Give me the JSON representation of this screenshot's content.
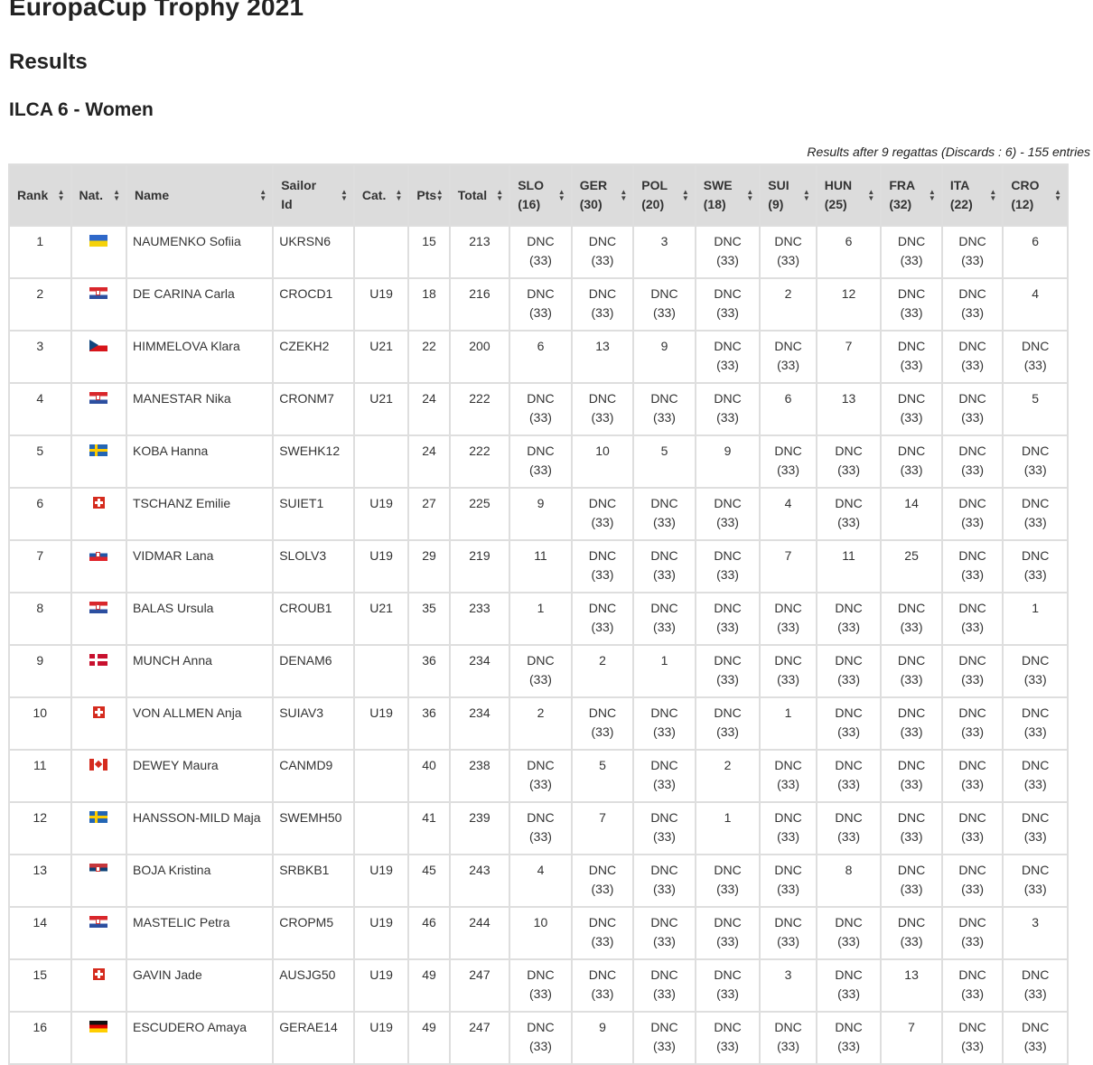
{
  "page": {
    "title": "EuropaCup Trophy 2021",
    "section": "Results",
    "category": "ILCA 6 - Women",
    "summary": "Results after 9 regattas (Discards : 6) - 155 entries"
  },
  "table": {
    "columns": [
      "Rank",
      "Nat.",
      "Name",
      "Sailor Id",
      "Cat.",
      "Pts",
      "Total",
      "SLO (16)",
      "GER (30)",
      "POL (20)",
      "SWE (18)",
      "SUI (9)",
      "HUN (25)",
      "FRA (32)",
      "ITA (22)",
      "CRO (12)"
    ],
    "rows": [
      {
        "rank": "1",
        "flag": "ukr",
        "name": "NAUMENKO Sofiia",
        "id": "UKRSN6",
        "cat": "",
        "pts": "15",
        "total": "213",
        "r": [
          [
            "DNC",
            "(33)"
          ],
          [
            "DNC",
            "(33)"
          ],
          [
            "3",
            ""
          ],
          [
            "DNC",
            "(33)"
          ],
          [
            "DNC",
            "(33)"
          ],
          [
            "6",
            ""
          ],
          [
            "DNC",
            "(33)"
          ],
          [
            "DNC",
            "(33)"
          ],
          [
            "6",
            ""
          ]
        ]
      },
      {
        "rank": "2",
        "flag": "cro",
        "name": "DE CARINA Carla",
        "id": "CROCD1",
        "cat": "U19",
        "pts": "18",
        "total": "216",
        "r": [
          [
            "DNC",
            "(33)"
          ],
          [
            "DNC",
            "(33)"
          ],
          [
            "DNC",
            "(33)"
          ],
          [
            "DNC",
            "(33)"
          ],
          [
            "2",
            ""
          ],
          [
            "12",
            ""
          ],
          [
            "DNC",
            "(33)"
          ],
          [
            "DNC",
            "(33)"
          ],
          [
            "4",
            ""
          ]
        ]
      },
      {
        "rank": "3",
        "flag": "cze",
        "name": "HIMMELOVA Klara",
        "id": "CZEKH2",
        "cat": "U21",
        "pts": "22",
        "total": "200",
        "r": [
          [
            "6",
            ""
          ],
          [
            "13",
            ""
          ],
          [
            "9",
            ""
          ],
          [
            "DNC",
            "(33)"
          ],
          [
            "DNC",
            "(33)"
          ],
          [
            "7",
            ""
          ],
          [
            "DNC",
            "(33)"
          ],
          [
            "DNC",
            "(33)"
          ],
          [
            "DNC",
            "(33)"
          ]
        ]
      },
      {
        "rank": "4",
        "flag": "cro",
        "name": "MANESTAR Nika",
        "id": "CRONM7",
        "cat": "U21",
        "pts": "24",
        "total": "222",
        "r": [
          [
            "DNC",
            "(33)"
          ],
          [
            "DNC",
            "(33)"
          ],
          [
            "DNC",
            "(33)"
          ],
          [
            "DNC",
            "(33)"
          ],
          [
            "6",
            ""
          ],
          [
            "13",
            ""
          ],
          [
            "DNC",
            "(33)"
          ],
          [
            "DNC",
            "(33)"
          ],
          [
            "5",
            ""
          ]
        ]
      },
      {
        "rank": "5",
        "flag": "swe",
        "name": "KOBA Hanna",
        "id": "SWEHK12",
        "cat": "",
        "pts": "24",
        "total": "222",
        "r": [
          [
            "DNC",
            "(33)"
          ],
          [
            "10",
            ""
          ],
          [
            "5",
            ""
          ],
          [
            "9",
            ""
          ],
          [
            "DNC",
            "(33)"
          ],
          [
            "DNC",
            "(33)"
          ],
          [
            "DNC",
            "(33)"
          ],
          [
            "DNC",
            "(33)"
          ],
          [
            "DNC",
            "(33)"
          ]
        ]
      },
      {
        "rank": "6",
        "flag": "sui",
        "name": "TSCHANZ Emilie",
        "id": "SUIET1",
        "cat": "U19",
        "pts": "27",
        "total": "225",
        "r": [
          [
            "9",
            ""
          ],
          [
            "DNC",
            "(33)"
          ],
          [
            "DNC",
            "(33)"
          ],
          [
            "DNC",
            "(33)"
          ],
          [
            "4",
            ""
          ],
          [
            "DNC",
            "(33)"
          ],
          [
            "14",
            ""
          ],
          [
            "DNC",
            "(33)"
          ],
          [
            "DNC",
            "(33)"
          ]
        ]
      },
      {
        "rank": "7",
        "flag": "slo",
        "name": "VIDMAR Lana",
        "id": "SLOLV3",
        "cat": "U19",
        "pts": "29",
        "total": "219",
        "r": [
          [
            "11",
            ""
          ],
          [
            "DNC",
            "(33)"
          ],
          [
            "DNC",
            "(33)"
          ],
          [
            "DNC",
            "(33)"
          ],
          [
            "7",
            ""
          ],
          [
            "11",
            ""
          ],
          [
            "25",
            ""
          ],
          [
            "DNC",
            "(33)"
          ],
          [
            "DNC",
            "(33)"
          ]
        ]
      },
      {
        "rank": "8",
        "flag": "cro",
        "name": "BALAS Ursula",
        "id": "CROUB1",
        "cat": "U21",
        "pts": "35",
        "total": "233",
        "r": [
          [
            "1",
            ""
          ],
          [
            "DNC",
            "(33)"
          ],
          [
            "DNC",
            "(33)"
          ],
          [
            "DNC",
            "(33)"
          ],
          [
            "DNC",
            "(33)"
          ],
          [
            "DNC",
            "(33)"
          ],
          [
            "DNC",
            "(33)"
          ],
          [
            "DNC",
            "(33)"
          ],
          [
            "1",
            ""
          ]
        ]
      },
      {
        "rank": "9",
        "flag": "den",
        "name": "MUNCH Anna",
        "id": "DENAM6",
        "cat": "",
        "pts": "36",
        "total": "234",
        "r": [
          [
            "DNC",
            "(33)"
          ],
          [
            "2",
            ""
          ],
          [
            "1",
            ""
          ],
          [
            "DNC",
            "(33)"
          ],
          [
            "DNC",
            "(33)"
          ],
          [
            "DNC",
            "(33)"
          ],
          [
            "DNC",
            "(33)"
          ],
          [
            "DNC",
            "(33)"
          ],
          [
            "DNC",
            "(33)"
          ]
        ]
      },
      {
        "rank": "10",
        "flag": "sui",
        "name": "VON ALLMEN Anja",
        "id": "SUIAV3",
        "cat": "U19",
        "pts": "36",
        "total": "234",
        "r": [
          [
            "2",
            ""
          ],
          [
            "DNC",
            "(33)"
          ],
          [
            "DNC",
            "(33)"
          ],
          [
            "DNC",
            "(33)"
          ],
          [
            "1",
            ""
          ],
          [
            "DNC",
            "(33)"
          ],
          [
            "DNC",
            "(33)"
          ],
          [
            "DNC",
            "(33)"
          ],
          [
            "DNC",
            "(33)"
          ]
        ]
      },
      {
        "rank": "11",
        "flag": "can",
        "name": "DEWEY Maura",
        "id": "CANMD9",
        "cat": "",
        "pts": "40",
        "total": "238",
        "r": [
          [
            "DNC",
            "(33)"
          ],
          [
            "5",
            ""
          ],
          [
            "DNC",
            "(33)"
          ],
          [
            "2",
            ""
          ],
          [
            "DNC",
            "(33)"
          ],
          [
            "DNC",
            "(33)"
          ],
          [
            "DNC",
            "(33)"
          ],
          [
            "DNC",
            "(33)"
          ],
          [
            "DNC",
            "(33)"
          ]
        ]
      },
      {
        "rank": "12",
        "flag": "swe",
        "name": "HANSSON-MILD Maja",
        "id": "SWEMH50",
        "cat": "",
        "pts": "41",
        "total": "239",
        "r": [
          [
            "DNC",
            "(33)"
          ],
          [
            "7",
            ""
          ],
          [
            "DNC",
            "(33)"
          ],
          [
            "1",
            ""
          ],
          [
            "DNC",
            "(33)"
          ],
          [
            "DNC",
            "(33)"
          ],
          [
            "DNC",
            "(33)"
          ],
          [
            "DNC",
            "(33)"
          ],
          [
            "DNC",
            "(33)"
          ]
        ]
      },
      {
        "rank": "13",
        "flag": "srb",
        "name": "BOJA Kristina",
        "id": "SRBKB1",
        "cat": "U19",
        "pts": "45",
        "total": "243",
        "r": [
          [
            "4",
            ""
          ],
          [
            "DNC",
            "(33)"
          ],
          [
            "DNC",
            "(33)"
          ],
          [
            "DNC",
            "(33)"
          ],
          [
            "DNC",
            "(33)"
          ],
          [
            "8",
            ""
          ],
          [
            "DNC",
            "(33)"
          ],
          [
            "DNC",
            "(33)"
          ],
          [
            "DNC",
            "(33)"
          ]
        ]
      },
      {
        "rank": "14",
        "flag": "cro",
        "name": "MASTELIC Petra",
        "id": "CROPM5",
        "cat": "U19",
        "pts": "46",
        "total": "244",
        "r": [
          [
            "10",
            ""
          ],
          [
            "DNC",
            "(33)"
          ],
          [
            "DNC",
            "(33)"
          ],
          [
            "DNC",
            "(33)"
          ],
          [
            "DNC",
            "(33)"
          ],
          [
            "DNC",
            "(33)"
          ],
          [
            "DNC",
            "(33)"
          ],
          [
            "DNC",
            "(33)"
          ],
          [
            "3",
            ""
          ]
        ]
      },
      {
        "rank": "15",
        "flag": "sui",
        "name": "GAVIN Jade",
        "id": "AUSJG50",
        "cat": "U19",
        "pts": "49",
        "total": "247",
        "r": [
          [
            "DNC",
            "(33)"
          ],
          [
            "DNC",
            "(33)"
          ],
          [
            "DNC",
            "(33)"
          ],
          [
            "DNC",
            "(33)"
          ],
          [
            "3",
            ""
          ],
          [
            "DNC",
            "(33)"
          ],
          [
            "13",
            ""
          ],
          [
            "DNC",
            "(33)"
          ],
          [
            "DNC",
            "(33)"
          ]
        ]
      },
      {
        "rank": "16",
        "flag": "ger",
        "name": "ESCUDERO Amaya",
        "id": "GERAE14",
        "cat": "U19",
        "pts": "49",
        "total": "247",
        "r": [
          [
            "DNC",
            "(33)"
          ],
          [
            "9",
            ""
          ],
          [
            "DNC",
            "(33)"
          ],
          [
            "DNC",
            "(33)"
          ],
          [
            "DNC",
            "(33)"
          ],
          [
            "DNC",
            "(33)"
          ],
          [
            "7",
            ""
          ],
          [
            "DNC",
            "(33)"
          ],
          [
            "DNC",
            "(33)"
          ]
        ]
      }
    ]
  }
}
